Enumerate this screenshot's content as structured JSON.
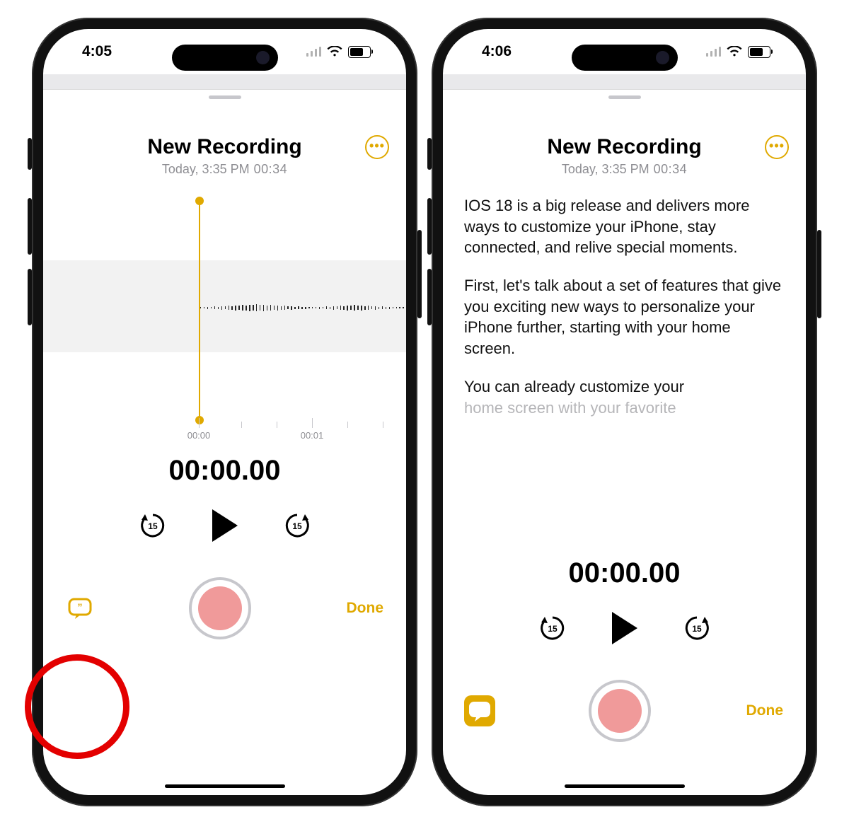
{
  "left": {
    "status_time": "4:05",
    "title": "New Recording",
    "subtitle": "Today, 3:35 PM",
    "duration_label": "00:34",
    "timer": "00:00.00",
    "done_label": "Done",
    "wave_ruler": {
      "t0": "00:00",
      "t1": "00:01"
    },
    "skip_seconds": "15"
  },
  "right": {
    "status_time": "4:06",
    "title": "New Recording",
    "subtitle": "Today, 3:35 PM",
    "duration_label": "00:34",
    "timer": "00:00.00",
    "done_label": "Done",
    "skip_seconds": "15",
    "transcript": {
      "p1": "IOS 18 is a big release and delivers more ways to customize your iPhone, stay connected, and relive special moments.",
      "p2": "First, let's talk about a set of features that give you exciting new ways to personalize your iPhone further, starting with your home screen.",
      "p3_visible": "You can already customize your",
      "p3_faded": "home screen with your favorite"
    }
  }
}
